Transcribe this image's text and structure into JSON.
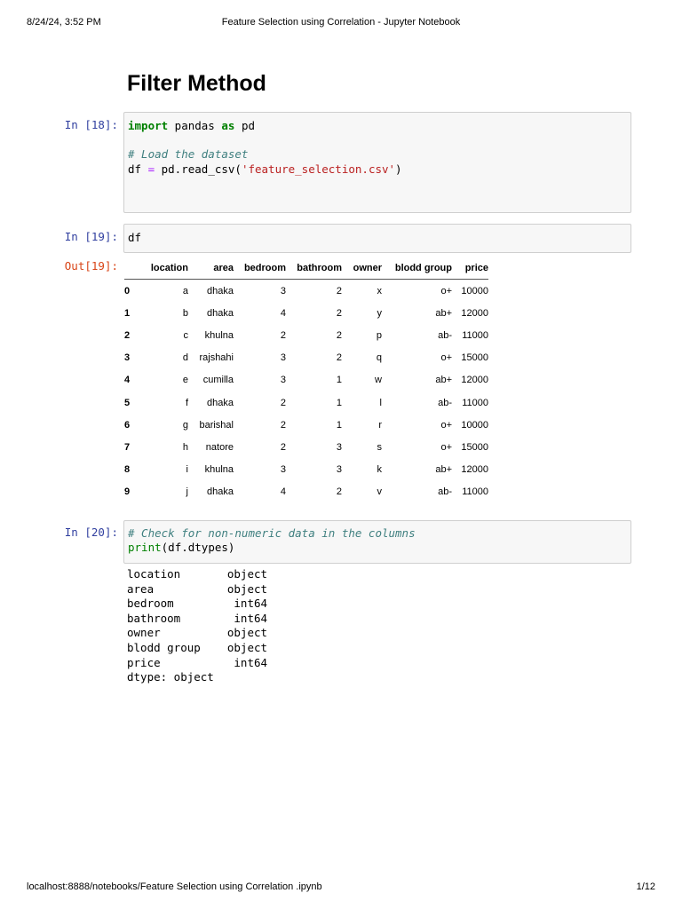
{
  "print_header": {
    "datetime": "8/24/24, 3:52 PM",
    "title": "Feature Selection using Correlation - Jupyter Notebook"
  },
  "print_footer": {
    "url": "localhost:8888/notebooks/Feature Selection using Correlation .ipynb",
    "page": "1/12"
  },
  "heading": "Filter Method",
  "cells": [
    {
      "prompt": "In [18]:",
      "code": {
        "l1_kw1": "import",
        "l1_mid": " pandas ",
        "l1_kw2": "as",
        "l1_end": " pd",
        "comment": "# Load the dataset",
        "l3_start": "df ",
        "l3_op": "=",
        "l3_mid": " pd.read_csv(",
        "l3_str": "'feature_selection.csv'",
        "l3_end": ")"
      }
    },
    {
      "prompt": "In [19]:",
      "code": "df",
      "out_prompt": "Out[19]:"
    },
    {
      "prompt": "In [20]:",
      "code": {
        "comment": "# Check for non-numeric data in the columns",
        "fn": "print",
        "rest": "(df.dtypes)"
      },
      "output": [
        "location       object",
        "area           object",
        "bedroom         int64",
        "bathroom        int64",
        "owner          object",
        "blodd group    object",
        "price           int64",
        "dtype: object"
      ]
    }
  ],
  "table": {
    "columns": [
      "",
      "location",
      "area",
      "bedroom",
      "bathroom",
      "owner",
      "blodd group",
      "price"
    ],
    "rows": [
      [
        "0",
        "a",
        "dhaka",
        "3",
        "2",
        "x",
        "o+",
        "10000"
      ],
      [
        "1",
        "b",
        "dhaka",
        "4",
        "2",
        "y",
        "ab+",
        "12000"
      ],
      [
        "2",
        "c",
        "khulna",
        "2",
        "2",
        "p",
        "ab-",
        "11000"
      ],
      [
        "3",
        "d",
        "rajshahi",
        "3",
        "2",
        "q",
        "o+",
        "15000"
      ],
      [
        "4",
        "e",
        "cumilla",
        "3",
        "1",
        "w",
        "ab+",
        "12000"
      ],
      [
        "5",
        "f",
        "dhaka",
        "2",
        "1",
        "l",
        "ab-",
        "11000"
      ],
      [
        "6",
        "g",
        "barishal",
        "2",
        "1",
        "r",
        "o+",
        "10000"
      ],
      [
        "7",
        "h",
        "natore",
        "2",
        "3",
        "s",
        "o+",
        "15000"
      ],
      [
        "8",
        "i",
        "khulna",
        "3",
        "3",
        "k",
        "ab+",
        "12000"
      ],
      [
        "9",
        "j",
        "dhaka",
        "4",
        "2",
        "v",
        "ab-",
        "11000"
      ]
    ]
  }
}
